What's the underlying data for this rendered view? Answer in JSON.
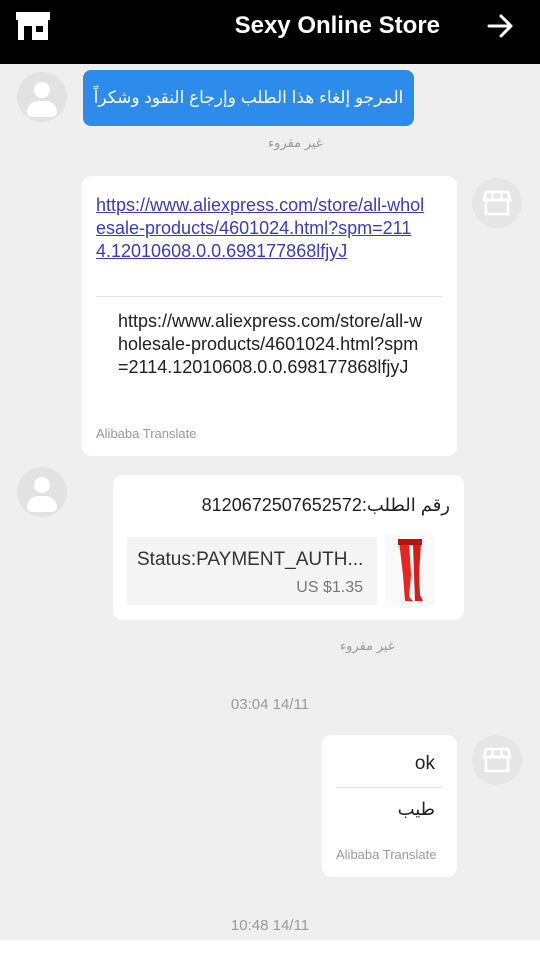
{
  "header": {
    "title": "Sexy Online Store",
    "store_icon": "store-icon",
    "forward_icon": "arrow-right-icon"
  },
  "messages": {
    "m1": {
      "text": "المرجو إلغاء هذا الطلب وإرجاع النقود وشكراً",
      "status": "غير مقروء"
    },
    "m2": {
      "link": "https://www.aliexpress.com/store/all-wholesale-products/4601024.html?spm=2114.12010608.0.0.698177868lfjyJ",
      "translation": "https://www.aliexpress.com/store/all-wholesale-products/4601024.html?spm=2114.12010608.0.0.698177868lfjyJ",
      "credit": "Alibaba Translate"
    },
    "m3": {
      "order_label": "رقم الطلب:8120672507652572",
      "order_status": "Status:PAYMENT_AUTH...",
      "price": "US $1.35",
      "status": "غير مقروء"
    },
    "time1": "03:04 14/11",
    "m4": {
      "text": "ok",
      "translation": "طيب",
      "credit": "Alibaba Translate"
    },
    "time2": "10:48 14/11"
  },
  "colors": {
    "header_bg": "#000000",
    "bubble_blue": "#2d8ceb",
    "link": "#3b3bc0"
  }
}
